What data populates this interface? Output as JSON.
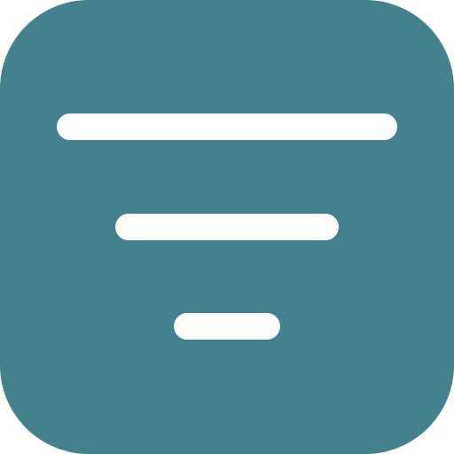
{
  "icon": {
    "name": "filter-icon",
    "background_color": "#43818D",
    "bar_color": "#FFFFFF"
  }
}
